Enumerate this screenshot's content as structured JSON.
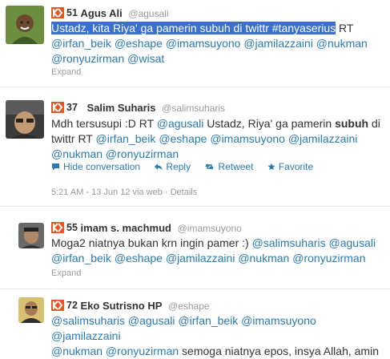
{
  "tweets": [
    {
      "score": "51",
      "name": "Agus Ali",
      "handle": "@agusali",
      "text_highlighted": "Ustadz, kita Riya' ga pamerin subuh di twittr #tanyaserius",
      "text_after": " RT",
      "line2": [
        "@irfan_beik",
        "@eshape",
        "@imamsuyono",
        "@jamilazzaini",
        "@nukman"
      ],
      "line3": [
        "@ronyuzirman",
        "@wisat"
      ],
      "expand": "Expand"
    },
    {
      "score": "37",
      "name": "Salim Suharis",
      "handle": "@salimsuharis",
      "line1_pre": "Mdh tersusupi :D RT ",
      "line1_mention": "@agusali",
      "line1_mid": " Ustadz, Riya' ga pamerin ",
      "line1_bold": "subuh",
      "line1_end": " di",
      "line2_pre": "twittr RT ",
      "line2": [
        "@irfan_beik",
        "@eshape",
        "@imamsuyono",
        "@jamilazzaini"
      ],
      "line3": [
        "@nukman",
        "@ronyuzirman"
      ],
      "actions": {
        "hide": "Hide conversation",
        "reply": "Reply",
        "retweet": "Retweet",
        "favorite": "Favorite"
      },
      "timestamp": "5:21 AM - 13 Jun 12 via web",
      "details": "Details"
    },
    {
      "score": "55",
      "name": "imam s. machmud",
      "handle": "@imamsuyono",
      "line1_pre": "Moga2 niatnya bukan krn ingin pamer :) ",
      "line1": [
        "@salimsuharis",
        "@agusali"
      ],
      "line2": [
        "@irfan_beik",
        "@eshape",
        "@jamilazzaini",
        "@nukman",
        "@ronyuzirman"
      ],
      "expand": "Expand"
    },
    {
      "score": "72",
      "name": "Eko Sutrisno HP",
      "handle": "@eshape",
      "line1": [
        "@salimsuharis",
        "@agusali",
        "@irfan_beik",
        "@imamsuyono",
        "@jamilazzaini"
      ],
      "line2": [
        "@nukman",
        "@ronyuzirman"
      ],
      "line2_after": " semoga niatnya epos, insya Allah, amin"
    }
  ],
  "colors": {
    "klout": "#e8541f",
    "link": "#2a7ab0",
    "highlight": "#3a6fd1",
    "muted": "#999999"
  }
}
